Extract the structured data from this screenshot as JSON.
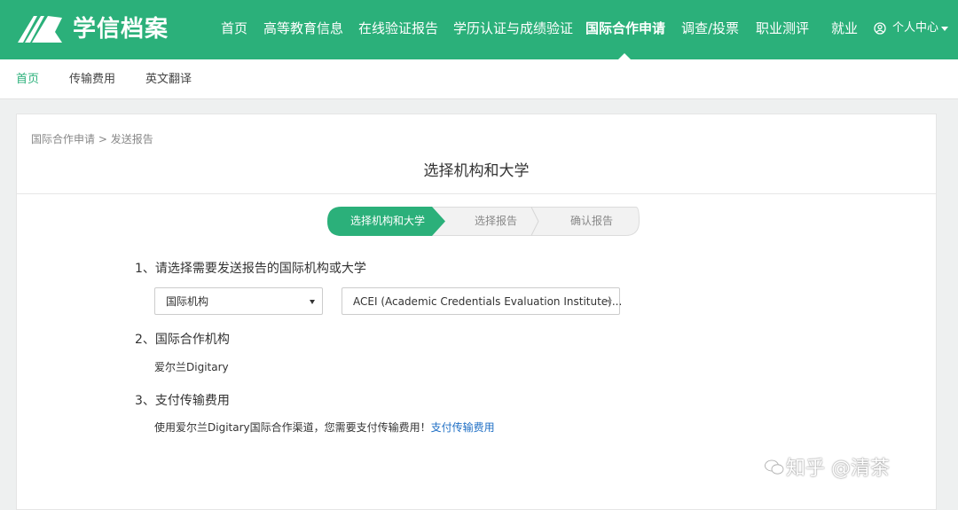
{
  "header": {
    "brand": "学信档案",
    "nav": [
      {
        "label": "首页"
      },
      {
        "label": "高等教育信息"
      },
      {
        "label": "在线验证报告"
      },
      {
        "label": "学历认证与成绩验证"
      },
      {
        "label": "国际合作申请",
        "active": true
      },
      {
        "label": "调查/投票"
      },
      {
        "label": "职业测评"
      },
      {
        "label": "就业"
      }
    ],
    "user_menu": "个人中心",
    "icons": {
      "logo": "book-logo-icon",
      "user": "user-circle-icon",
      "caret": "caret-down-icon"
    },
    "color": "#2bb07a"
  },
  "subnav": {
    "items": [
      {
        "label": "首页",
        "active": true
      },
      {
        "label": "传输费用"
      },
      {
        "label": "英文翻译"
      }
    ]
  },
  "breadcrumb": {
    "parent": "国际合作申请",
    "separator": ">",
    "current": "发送报告"
  },
  "page_title": "选择机构和大学",
  "steps": [
    {
      "label": "选择机构和大学",
      "active": true
    },
    {
      "label": "选择报告"
    },
    {
      "label": "确认报告"
    }
  ],
  "section1": {
    "title": "1、请选择需要发送报告的国际机构或大学",
    "type_select": "国际机构",
    "org_select": "ACEI (Academic Credentials Evaluation Institute)..."
  },
  "section2": {
    "title": "2、国际合作机构",
    "value": "爱尔兰Digitary"
  },
  "section3": {
    "title": "3、支付传输费用",
    "text": "使用爱尔兰Digitary国际合作渠道，您需要支付传输费用！",
    "link": "支付传输费用"
  },
  "watermark": "知乎 @清茶"
}
